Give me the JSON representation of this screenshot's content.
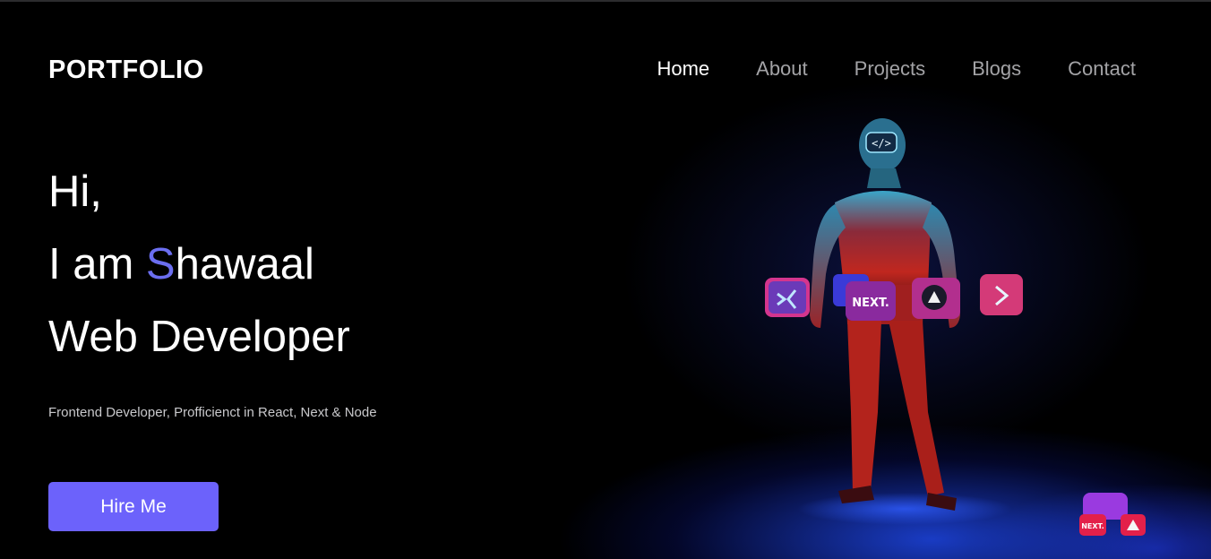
{
  "brand": {
    "logo": "PORTFOLIO"
  },
  "nav": {
    "items": [
      {
        "label": "Home",
        "active": true
      },
      {
        "label": "About",
        "active": false
      },
      {
        "label": "Projects",
        "active": false
      },
      {
        "label": "Blogs",
        "active": false
      },
      {
        "label": "Contact",
        "active": false
      }
    ]
  },
  "hero": {
    "greeting": "Hi,",
    "intro_prefix": "I am ",
    "name_initial": "S",
    "name_rest": "hawaal",
    "role": "Web Developer",
    "tagline": "Frontend Developer, Profficienct in React, Next & Node",
    "cta_label": "Hire Me"
  },
  "figure": {
    "head_badge": "</>",
    "cube_labels": [
      "NEXT.",
      "NEXT."
    ]
  },
  "colors": {
    "accent": "#6b6ef0",
    "button": "#6c62fb",
    "nav_inactive": "#a3a3a6",
    "background": "#000000"
  }
}
